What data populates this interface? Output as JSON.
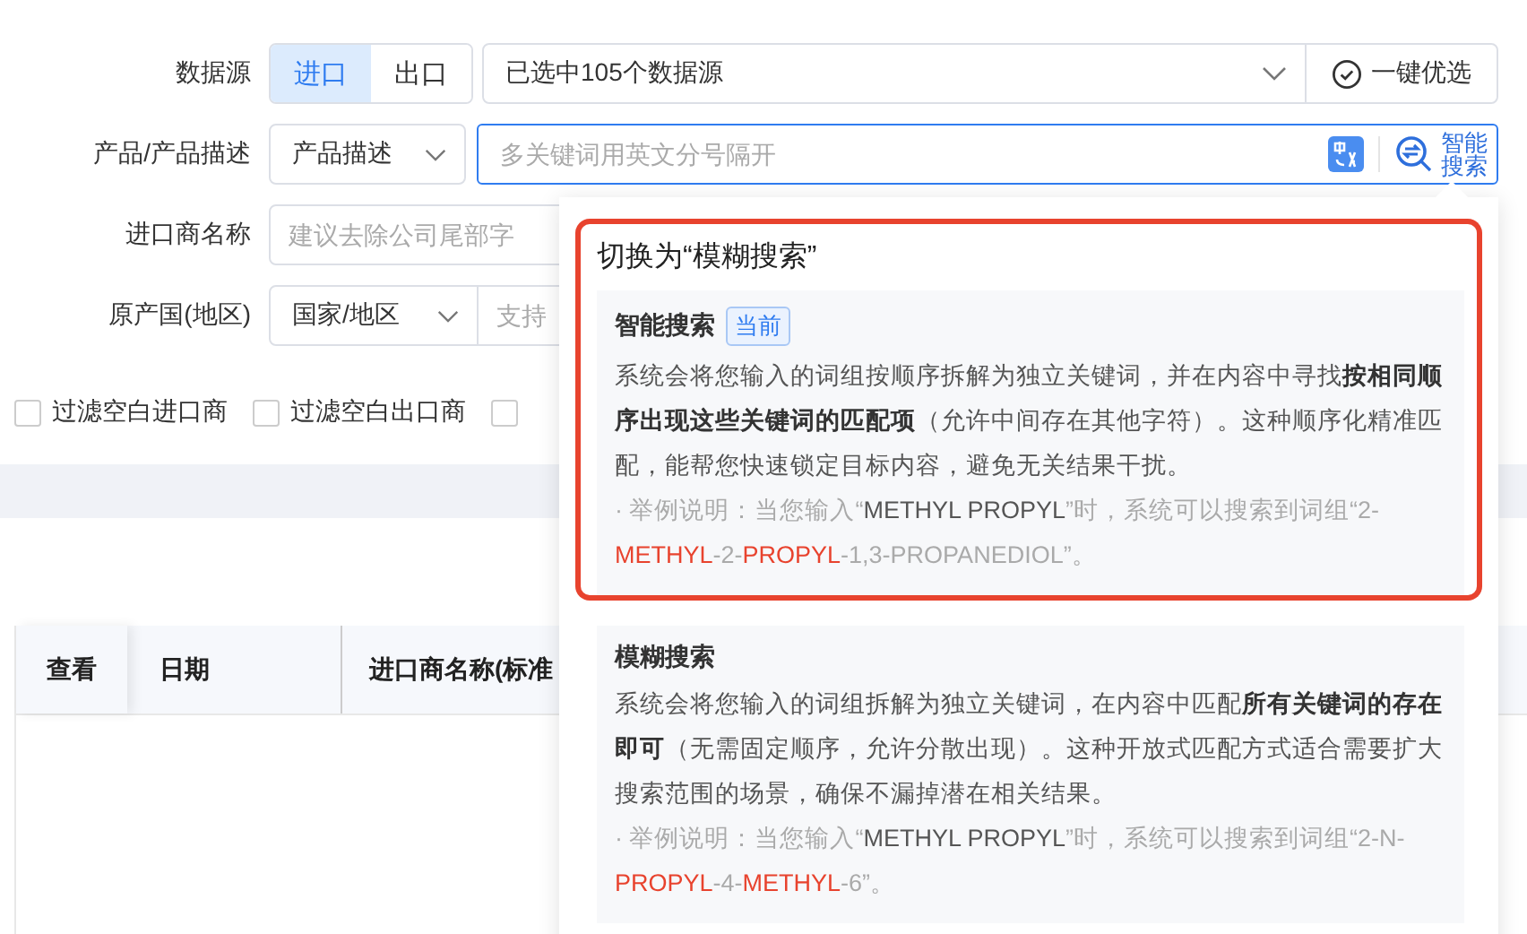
{
  "form": {
    "source": {
      "label": "数据源",
      "options": [
        {
          "label": "进口",
          "selected": true
        },
        {
          "label": "出口",
          "selected": false
        }
      ],
      "select_value": "已选中105个数据源",
      "button": "一键优选"
    },
    "product": {
      "label": "产品/产品描述",
      "select_value": "产品描述",
      "placeholder": "多关键词用英文分号隔开",
      "search_button": "智能搜索"
    },
    "importer": {
      "label": "进口商名称",
      "placeholder": "建议去除公司尾部字"
    },
    "origin": {
      "label": "原产国(地区)",
      "select_value": "国家/地区",
      "placeholder": "支持"
    },
    "filters": [
      {
        "label": "过滤空白进口商",
        "checked": false
      },
      {
        "label": "过滤空白出口商",
        "checked": false
      },
      {
        "checked": false
      }
    ]
  },
  "table": {
    "columns": [
      "查看",
      "日期",
      "进口商名称(标准"
    ]
  },
  "popover": {
    "title": "切换为“模糊搜索”",
    "modes": [
      {
        "name": "智能搜索",
        "badge": "当前",
        "highlighted": true,
        "description": "系统会将您输入的词组按顺序拆解为独立关键词，并在内容中寻找**按相同顺序出现这些关键词的匹配项**（允许中间存在其他字符）。这种顺序化精准匹配，能帮您快速锁定目标内容，避免无关结果干扰。",
        "example": [
          {
            "text": "· 举例说明：当您输入“",
            "kind": "muted"
          },
          {
            "text": "METHYL PROPYL",
            "kind": "term"
          },
          {
            "text": "”时，系统可以搜索到词组“2-",
            "kind": "muted"
          },
          {
            "text": "METHYL",
            "kind": "match"
          },
          {
            "text": "-2-",
            "kind": "muted"
          },
          {
            "text": "PROPYL",
            "kind": "match"
          },
          {
            "text": "-1,3-PROPANEDIOL”。",
            "kind": "muted"
          }
        ]
      },
      {
        "name": "模糊搜索",
        "highlighted": false,
        "description": "系统会将您输入的词组拆解为独立关键词，在内容中匹配**所有关键词的存在即可**（无需固定顺序，允许分散出现）。这种开放式匹配方式适合需要扩大搜索范围的场景，确保不漏掉潜在相关结果。",
        "example": [
          {
            "text": "· 举例说明：当您输入“",
            "kind": "muted"
          },
          {
            "text": "METHYL PROPYL",
            "kind": "term"
          },
          {
            "text": "”时，系统可以搜索到词组“2-N-",
            "kind": "muted"
          },
          {
            "text": "PROPYL",
            "kind": "match"
          },
          {
            "text": "-4-",
            "kind": "muted"
          },
          {
            "text": "METHYL",
            "kind": "match"
          },
          {
            "text": "-6”。",
            "kind": "muted"
          }
        ]
      }
    ]
  }
}
